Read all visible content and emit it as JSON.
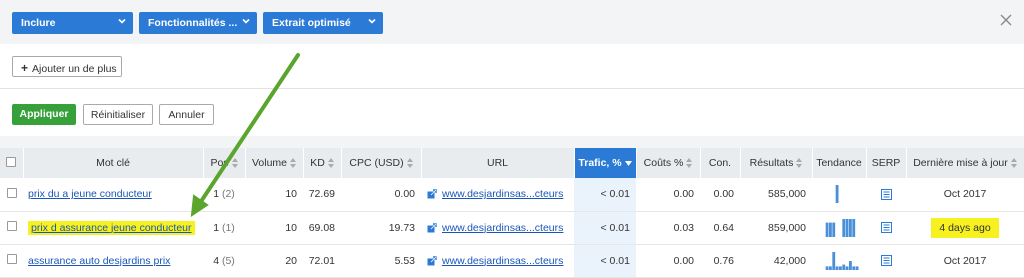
{
  "filters": [
    {
      "label": "Inclure"
    },
    {
      "label": "Fonctionnalités ..."
    },
    {
      "label": "Extrait optimisé"
    }
  ],
  "add_button": "Ajouter un de plus",
  "actions": {
    "apply": "Appliquer",
    "reset": "Réinitialiser",
    "cancel": "Annuler"
  },
  "table": {
    "headers": [
      "Mot clé",
      "Pos",
      "Volume",
      "KD",
      "CPC (USD)",
      "URL",
      "Trafic, %",
      "Coûts %",
      "Con.",
      "Résultats",
      "Tendance",
      "SERP",
      "Dernière mise à jour"
    ],
    "rows": [
      {
        "keyword": "prix du a jeune conducteur",
        "pos": "1",
        "pos_prev": "(2)",
        "volume": "10",
        "kd": "72.69",
        "cpc": "0.00",
        "url": "www.desjardinsas...cteurs",
        "traffic": "< 0.01",
        "costs": "0.00",
        "con": "0.00",
        "results": "585,000",
        "trend": [
          0,
          0,
          0,
          0,
          0,
          1,
          0,
          0,
          0,
          0,
          0,
          0
        ],
        "updated": "Oct 2017",
        "highlight": false
      },
      {
        "keyword": "prix d assurance jeune conducteur",
        "pos": "1",
        "pos_prev": "(1)",
        "volume": "10",
        "kd": "69.08",
        "cpc": "19.73",
        "url": "www.desjardinsas...cteurs",
        "traffic": "< 0.01",
        "costs": "0.03",
        "con": "0.64",
        "results": "859,000",
        "trend": [
          0,
          0,
          0.8,
          0.8,
          0.8,
          0,
          0,
          1,
          1,
          1,
          1,
          0
        ],
        "updated": "4 days ago",
        "highlight": true
      },
      {
        "keyword": "assurance auto desjardins prix",
        "pos": "4",
        "pos_prev": "(5)",
        "volume": "20",
        "kd": "72.01",
        "cpc": "5.53",
        "url": "www.desjardinsas...cteurs",
        "traffic": "< 0.01",
        "costs": "0.00",
        "con": "0.76",
        "results": "42,000",
        "trend": [
          0,
          0,
          0.2,
          0.2,
          1,
          0.2,
          0.2,
          0.3,
          0.2,
          0.5,
          0.2,
          0.2
        ],
        "updated": "Oct 2017",
        "highlight": false
      }
    ]
  },
  "colors": {
    "accent": "#2b7bd6",
    "apply": "#36a03b",
    "highlight": "#f7f11f",
    "arrow": "#5aa52d",
    "trend": "#4a90d9"
  }
}
